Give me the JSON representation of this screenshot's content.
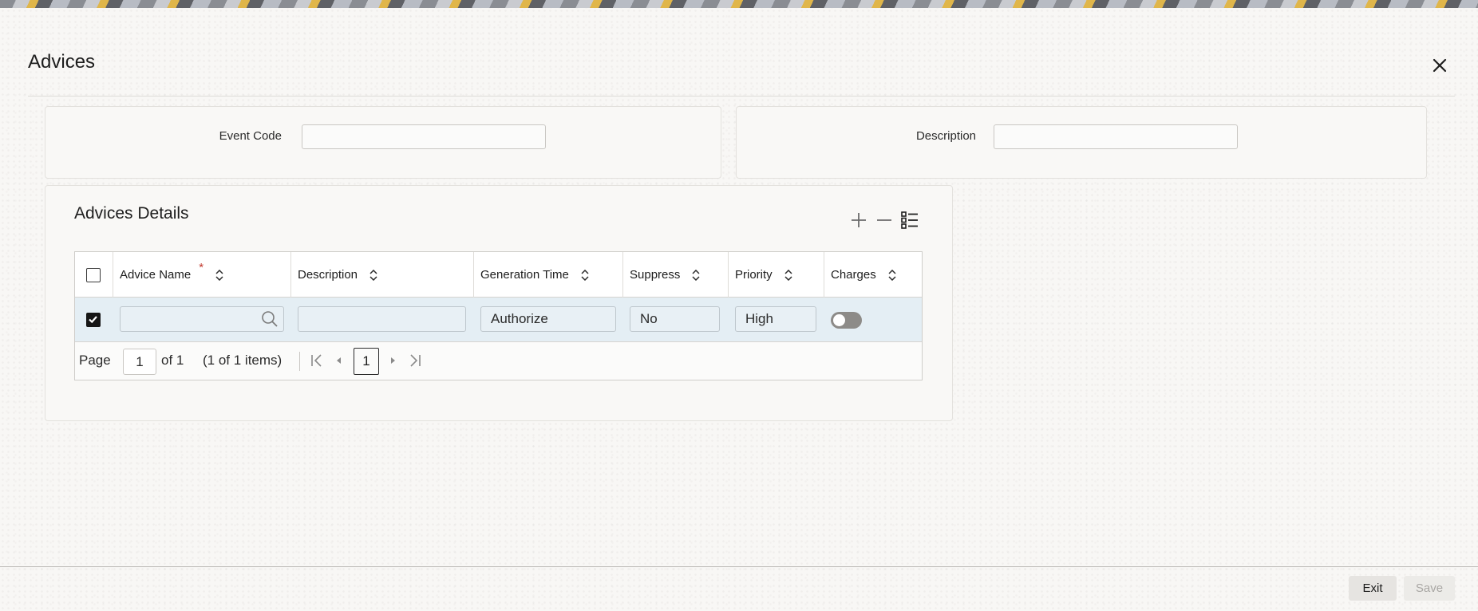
{
  "window": {
    "title": "Advices"
  },
  "header_fields": {
    "event_code": {
      "label": "Event Code",
      "value": ""
    },
    "description": {
      "label": "Description",
      "value": ""
    }
  },
  "advices_details": {
    "title": "Advices Details",
    "toolbar": {
      "add_icon": "plus-icon",
      "remove_icon": "minus-icon",
      "view_icon": "list-view-icon"
    },
    "columns": [
      {
        "label": "Advice Name",
        "required": true
      },
      {
        "label": "Description",
        "required": false
      },
      {
        "label": "Generation Time",
        "required": false
      },
      {
        "label": "Suppress",
        "required": false
      },
      {
        "label": "Priority",
        "required": false
      },
      {
        "label": "Charges",
        "required": false
      }
    ],
    "required_marker": "*",
    "rows": [
      {
        "selected": true,
        "advice_name": "",
        "description": "",
        "generation_time": "Authorize",
        "suppress": "No",
        "priority": "High",
        "charges": false
      }
    ],
    "pagination": {
      "page_label": "Page",
      "current_page": "1",
      "of_label": "of 1",
      "items_label": "(1 of 1 items)",
      "page_button": "1"
    }
  },
  "footer": {
    "exit_label": "Exit",
    "save_label": "Save"
  },
  "colors": {
    "selected_row": "#e4eef4",
    "required": "#c23a2e",
    "toggle_off": "#8d8b88"
  }
}
